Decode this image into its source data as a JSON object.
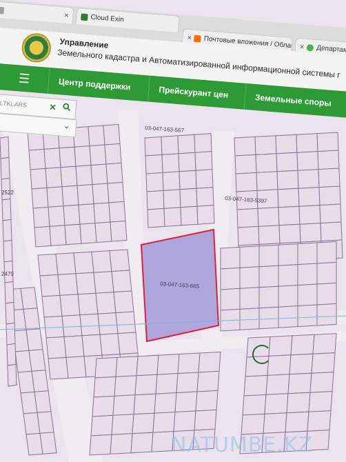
{
  "browser": {
    "tabs": [
      {
        "label": "",
        "favicon_color": "#9e9e9e"
      },
      {
        "label": "Cloud Exin",
        "favicon_color": "#2e7d32"
      },
      {
        "label": "Почтовые вложения / Облако",
        "favicon_color": "#ff6d00"
      },
      {
        "label": "Департамент",
        "favicon_color": "#4caf50"
      }
    ],
    "close_glyph": "×"
  },
  "site": {
    "org_title": "Управление",
    "org_subtitle": "Земельного кадастра и Автоматизированной информационной системы г",
    "menu_icon": "hamburger-icon",
    "nav": [
      "Центр поддержки",
      "Прейскурант цен",
      "Земельные споры"
    ]
  },
  "search": {
    "value": "HGRELTKLARS",
    "clear_icon": "close-icon",
    "search_icon": "search-icon",
    "dropdown_icon": "chevron-down-icon"
  },
  "map": {
    "parcel_labels": [
      "03-047-163-567",
      "03-047-163-5397",
      "03-047-163-665",
      "2522",
      "2479"
    ],
    "selected_parcel": "03-047-163-665",
    "selected_fill": "#a39ad8",
    "selected_border": "#e0203a"
  },
  "watermark": "NATUMBE.KZ"
}
